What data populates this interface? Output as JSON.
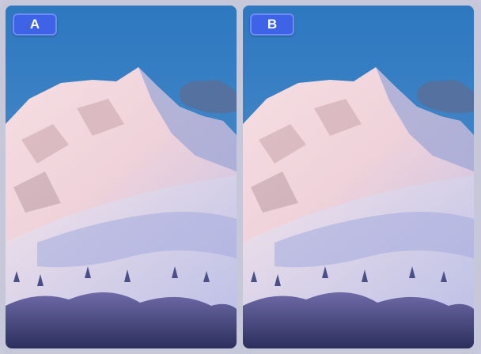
{
  "game": {
    "panels": [
      {
        "label": "A"
      },
      {
        "label": "B"
      }
    ],
    "colors": {
      "badge": "#3f63e6",
      "background": "#c6c8da",
      "sky": "#2f7bc1"
    }
  }
}
